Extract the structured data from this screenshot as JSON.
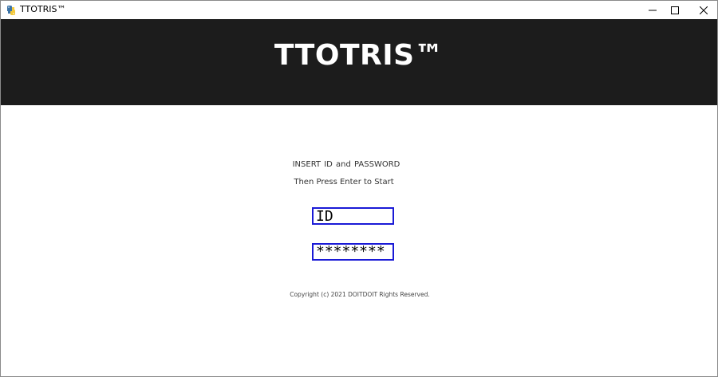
{
  "window": {
    "title": "TTOTRIS™",
    "icon": "python-icon",
    "controls": [
      "minimize",
      "maximize",
      "close"
    ]
  },
  "banner": {
    "title": "TTOTRIS™",
    "background": "#1c1c1c"
  },
  "login": {
    "instruction_line1": "INSERT ID  and  PASSWORD",
    "instruction_line2": "Then Press Enter to Start",
    "id_value": "ID",
    "password_value": "********",
    "field_border_color": "#1a1ad6"
  },
  "footer": {
    "copyright": "Copyright (c) 2021 DOITDOIT Rights Reserved."
  }
}
